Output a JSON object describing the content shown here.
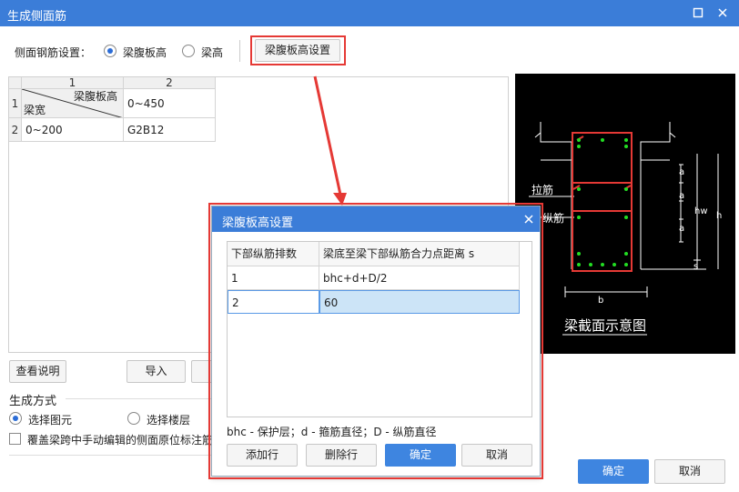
{
  "window": {
    "title": "生成侧面筋",
    "minimize_icon": "minimize-icon",
    "close_icon": "close-icon"
  },
  "side_rebar": {
    "label": "侧面钢筋设置：",
    "option1": "梁腹板高",
    "option2": "梁高",
    "selected": "梁腹板高",
    "settings_button": "梁腹板高设置"
  },
  "grid": {
    "col_headers": [
      "1",
      "2"
    ],
    "row_headers": [
      "1",
      "2"
    ],
    "corner_top": "梁腹板高",
    "corner_bottom": "梁宽",
    "r1c2": "0~450",
    "r2c1": "0~200",
    "r2c2": "G2B12"
  },
  "left_buttons": {
    "view_help": "查看说明",
    "import": "导入"
  },
  "generate": {
    "title": "生成方式",
    "option1": "选择图元",
    "option2": "选择楼层",
    "selected": "选择图元",
    "override_checkbox": "覆盖梁跨中手动编辑的侧面原位标注筋"
  },
  "diagram": {
    "caption": "梁截面示意图",
    "tie_label": "拉筋",
    "long_label": "纵筋",
    "a_label": "a",
    "hw_label": "hw",
    "h_label": "h",
    "s_label": "s",
    "b_label": "b"
  },
  "main_buttons": {
    "ok": "确定",
    "cancel": "取消"
  },
  "dialog": {
    "title": "梁腹板高设置",
    "close_icon": "close-icon",
    "headers": [
      "下部纵筋排数",
      "梁底至梁下部纵筋合力点距离 s"
    ],
    "rows": [
      [
        "1",
        "bhc+d+D/2"
      ],
      [
        "2",
        "60"
      ]
    ],
    "note": "bhc - 保护层；d - 箍筋直径；D - 纵筋直径",
    "buttons": {
      "add": "添加行",
      "delete": "删除行",
      "ok": "确定",
      "cancel": "取消"
    }
  },
  "colors": {
    "accent": "#3b7dd8",
    "highlight": "#e53935",
    "diagram_bg": "#000000"
  }
}
